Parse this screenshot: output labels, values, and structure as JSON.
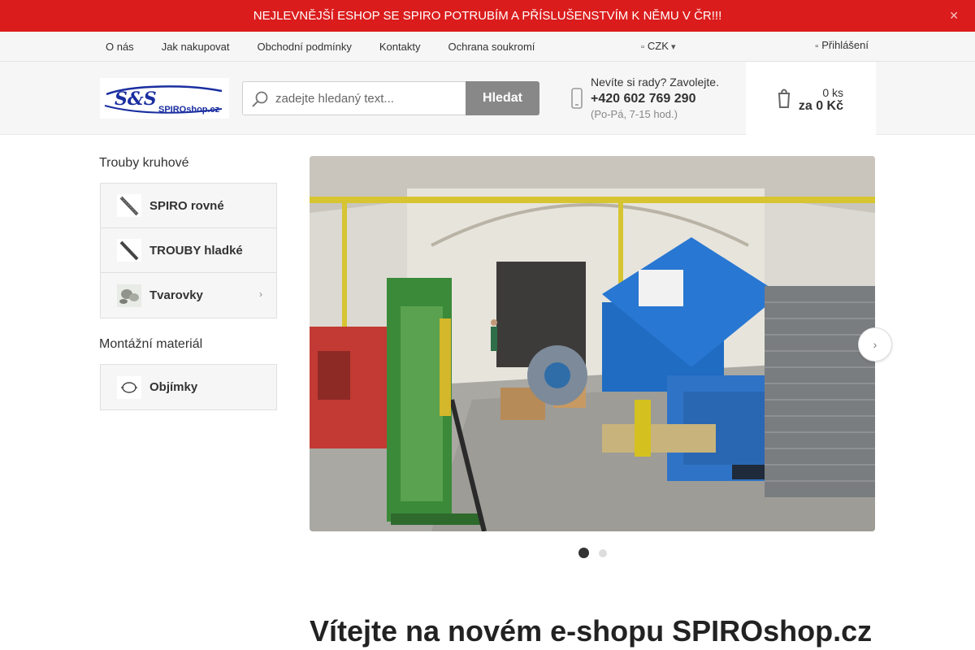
{
  "banner": {
    "text": "NEJLEVNĚJŠÍ ESHOP SE SPIRO POTRUBÍM A PŘÍSLUŠENSTVÍM K NĚMU V ČR!!!",
    "close_glyph": "✕"
  },
  "nav": {
    "links": [
      "O nás",
      "Jak nakupovat",
      "Obchodní podmínky",
      "Kontakty",
      "Ochrana soukromí"
    ],
    "currency": "CZK",
    "login": "Přihlášení"
  },
  "header": {
    "logo_alt": "SPIROshop.cz",
    "search": {
      "placeholder": "zadejte hledaný text...",
      "button": "Hledat"
    },
    "contact": {
      "question": "Nevíte si rady? Zavolejte.",
      "phone": "+420 602 769 290",
      "hours": "(Po-Pá, 7-15 hod.)"
    },
    "cart": {
      "count": "0 ks",
      "total": "za 0 Kč"
    }
  },
  "sidebar": {
    "groups": [
      {
        "title": "Trouby kruhové",
        "items": [
          {
            "label": "SPIRO rovné",
            "icon": "spiro-pipe-icon"
          },
          {
            "label": "TROUBY hladké",
            "icon": "smooth-pipe-icon"
          },
          {
            "label": "Tvarovky",
            "icon": "fittings-icon",
            "has_submenu": true
          }
        ]
      },
      {
        "title": "Montážní materiál",
        "items": [
          {
            "label": "Objímky",
            "icon": "clamp-icon"
          }
        ]
      }
    ]
  },
  "slider": {
    "image_alt": "Výrobní hala",
    "slides_count": 2,
    "active_slide": 1,
    "next_glyph": "›"
  },
  "main": {
    "welcome_title": "Vítejte na novém e-shopu SPIROshop.cz"
  },
  "colors": {
    "banner": "#db1c1c",
    "search_button": "#888888",
    "header_bg": "#f6f6f6"
  }
}
